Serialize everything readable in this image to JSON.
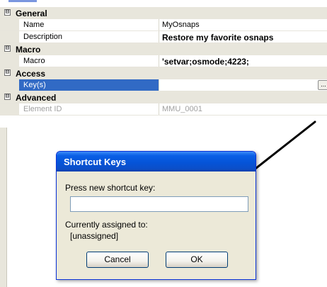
{
  "properties": {
    "categories": [
      {
        "label": "General",
        "expander": "⊟",
        "rows": [
          {
            "name": "Name",
            "value": "MyOsnaps"
          },
          {
            "name": "Description",
            "value": "Restore my favorite osnaps"
          }
        ]
      },
      {
        "label": "Macro",
        "expander": "⊟",
        "rows": [
          {
            "name": "Macro",
            "value": "'setvar;osmode;4223;"
          }
        ]
      },
      {
        "label": "Access",
        "expander": "⊟",
        "rows": [
          {
            "name": "Key(s)",
            "value": "",
            "button_label": "..."
          }
        ]
      },
      {
        "label": "Advanced",
        "expander": "⊟",
        "rows": [
          {
            "name": "Element ID",
            "value": "MMU_0001"
          }
        ]
      }
    ]
  },
  "dialog": {
    "title": "Shortcut Keys",
    "prompt": "Press new shortcut key:",
    "input_value": "",
    "assigned_label": "Currently assigned to:",
    "assigned_value": "[unassigned]",
    "cancel_label": "Cancel",
    "ok_label": "OK"
  },
  "colors": {
    "selection": "#316ac5",
    "category_band": "#e8e6dc",
    "dialog_titlebar": "#0554d8",
    "arrow": "#000000"
  }
}
